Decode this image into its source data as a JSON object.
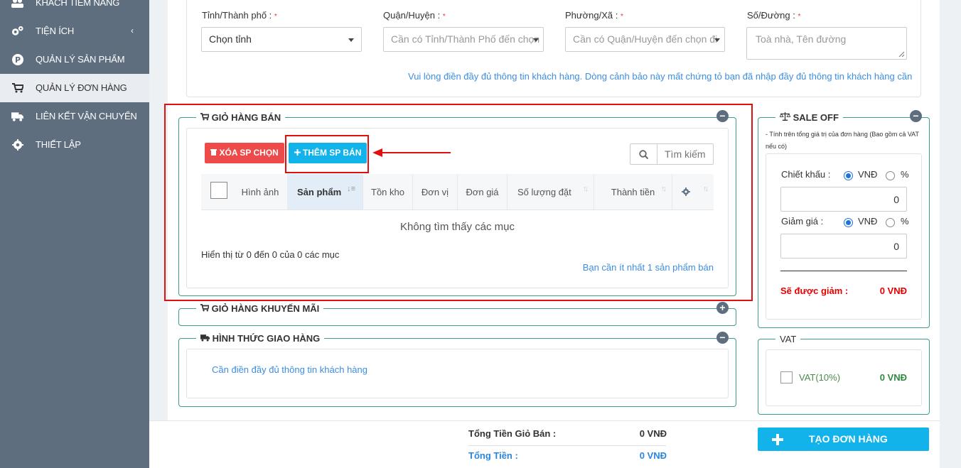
{
  "sidebar": {
    "items": [
      {
        "label": "KHÁCH TIỀM NĂNG",
        "icon": "users-icon"
      },
      {
        "label": "TIỆN ÍCH",
        "icon": "gears-icon"
      },
      {
        "label": "QUẢN LÝ SẢN PHẨM",
        "icon": "product-p-icon"
      },
      {
        "label": "QUẢN LÝ ĐƠN HÀNG",
        "icon": "cart-icon"
      },
      {
        "label": "LIÊN KẾT VẬN CHUYỂN",
        "icon": "truck-icon"
      },
      {
        "label": "THIẾT LẬP",
        "icon": "gear-icon"
      }
    ],
    "utility_chevron": "‹"
  },
  "address": {
    "province_label": "Tỉnh/Thành phố :",
    "district_label": "Quận/Huyện :",
    "ward_label": "Phường/Xã :",
    "street_label": "Số/Đường :",
    "required_mark": "*",
    "province_value": "Chọn tỉnh",
    "district_placeholder": "Cần có Tỉnh/Thành Phố đến chọn",
    "ward_placeholder": "Cần có Quận/Huyện đến chọn đi",
    "street_placeholder": "Toà nhà, Tên đường",
    "warning": "Vui lòng điền đầy đủ thông tin khách hàng. Dòng cảnh bảo này mất chứng tỏ bạn đã nhập đầy đủ thông tin khách hàng cần"
  },
  "cart": {
    "title": "GIỎ HÀNG BÁN",
    "delete_label": "XÓA SP CHỌN",
    "add_label": "THÊM SP BÁN",
    "search_placeholder": "Tìm kiếm",
    "columns": [
      "Hình ảnh",
      "Sản phẩm",
      "Tồn kho",
      "Đơn vị",
      "Đơn giá",
      "Số lượng đặt",
      "Thành tiền"
    ],
    "empty": "Không tìm thấy các mục",
    "info": "Hiển thị từ 0 đến 0 của 0 các mục",
    "min_note": "Bạn cần ít nhất 1 sản phẩm bán"
  },
  "promo_cart": {
    "title": "GIỎ HÀNG KHUYẾN MÃI"
  },
  "shipping": {
    "title": "HÌNH THỨC GIAO HÀNG",
    "note": "Cần điền đầy đủ thông tin khách hàng"
  },
  "sale_off": {
    "title": "SALE OFF",
    "note": "- Tính trên tổng giá trị của đơn hàng (Bao gồm cả VAT nếu có)",
    "discount_label": "Chiết khấu :",
    "reduce_label": "Giảm giá :",
    "opt_vnd": "VNĐ",
    "opt_pct": "%",
    "discount_value": "0",
    "reduce_value": "0",
    "result_label": "Sẽ được giảm :",
    "result_value": "0 VNĐ"
  },
  "vat": {
    "title": "VAT",
    "label": "VAT(10%)",
    "value": "0 VNĐ"
  },
  "totals": {
    "cart_total_label": "Tổng Tiền Giỏ Bán :",
    "cart_total_value": "0 VNĐ",
    "total_label": "Tổng Tiền :",
    "total_value": "0 VNĐ"
  },
  "create_order_label": "TẠO ĐƠN HÀNG",
  "colors": {
    "sidebar_bg": "#5f6e7f",
    "panel_border": "#3a9e91",
    "danger_button": "#ef4a4a",
    "primary_button": "#12b3ea",
    "annotation_red": "#e01010",
    "link_blue": "#3d8ee0"
  }
}
